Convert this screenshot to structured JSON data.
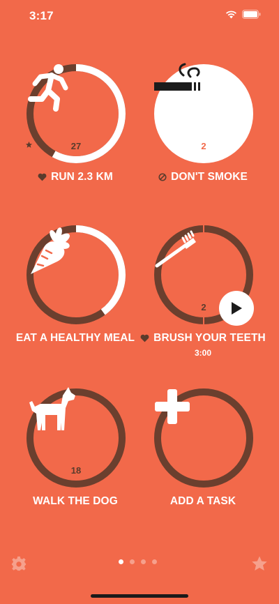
{
  "status": {
    "time": "3:17"
  },
  "tasks": [
    {
      "label": "RUN 2.3 KM",
      "count": "27",
      "progress": 0.58,
      "icon": "running-icon",
      "prefix_icon": "heart-icon"
    },
    {
      "label": "DON'T SMOKE",
      "count": "2",
      "progress": 1.0,
      "icon": "cigarette-icon",
      "prefix_icon": "prohibited-icon",
      "completed": true
    },
    {
      "label": "EAT A HEALTHY MEAL",
      "count": "",
      "progress": 0.4,
      "icon": "carrot-icon"
    },
    {
      "label": "BRUSH YOUR TEETH",
      "count": "2",
      "progress": 0.0,
      "icon": "toothbrush-icon",
      "prefix_icon": "heart-icon",
      "timer": "3:00"
    },
    {
      "label": "WALK THE DOG",
      "count": "18",
      "progress": 0.0,
      "icon": "dog-icon"
    },
    {
      "label": "ADD A TASK",
      "icon": "plus-icon"
    }
  ],
  "pager": {
    "pages": 4,
    "current": 0
  },
  "colors": {
    "background": "#f2694a",
    "ring_track": "#6b3f2e",
    "ring_progress": "#ffffff"
  }
}
